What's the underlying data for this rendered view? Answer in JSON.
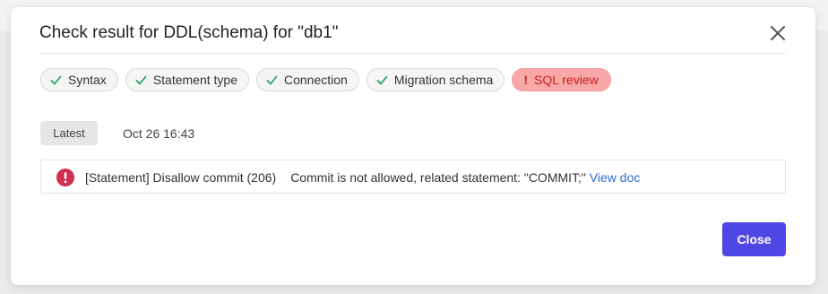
{
  "dialog": {
    "title": "Check result for DDL(schema) for \"db1\"",
    "close_icon": "close-icon"
  },
  "checks": [
    {
      "label": "Syntax",
      "status": "success",
      "icon": "check-icon"
    },
    {
      "label": "Statement type",
      "status": "success",
      "icon": "check-icon"
    },
    {
      "label": "Connection",
      "status": "success",
      "icon": "check-icon"
    },
    {
      "label": "Migration schema",
      "status": "success",
      "icon": "check-icon"
    },
    {
      "label": "SQL review",
      "status": "error",
      "icon": "exclamation-icon",
      "marker": "!"
    }
  ],
  "history": {
    "badge": "Latest",
    "timestamp": "Oct 26 16:43"
  },
  "result": {
    "icon": "error-circle-icon",
    "rule": "[Statement] Disallow commit (206)",
    "message": "Commit is not allowed, related statement: \"COMMIT;\"",
    "link": "View doc"
  },
  "footer": {
    "close_label": "Close"
  },
  "colors": {
    "success": "#18a058",
    "error_bg": "#f8a8a8",
    "error_text": "#c81e1e",
    "error_icon": "#d03050",
    "link": "#2e6bd6",
    "primary_button": "#4f46e5"
  }
}
